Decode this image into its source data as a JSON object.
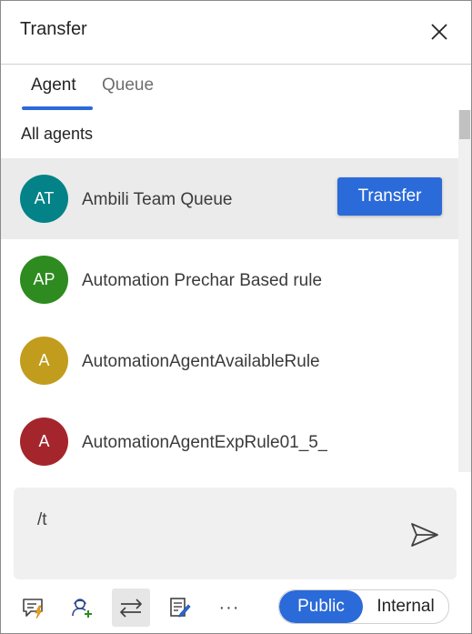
{
  "header": {
    "title": "Transfer",
    "close_icon": "close-icon"
  },
  "tabs": [
    {
      "label": "Agent",
      "selected": true
    },
    {
      "label": "Queue",
      "selected": false
    }
  ],
  "section_label": "All agents",
  "agents": [
    {
      "initials": "AT",
      "name": "Ambili Team Queue",
      "avatar_color": "#038387",
      "selected": true
    },
    {
      "initials": "AP",
      "name": "Automation Prechar Based rule",
      "avatar_color": "#2e8b1f",
      "selected": false
    },
    {
      "initials": "A",
      "name": "AutomationAgentAvailableRule",
      "avatar_color": "#c29c1d",
      "selected": false
    },
    {
      "initials": "A",
      "name": "AutomationAgentExpRule01_5_",
      "avatar_color": "#a4262c",
      "selected": false
    }
  ],
  "transfer_button": {
    "label": "Transfer"
  },
  "compose": {
    "text": "/t",
    "send_icon": "send-icon"
  },
  "toolbar": {
    "icons": [
      "quick-replies-icon",
      "add-participant-icon",
      "transfer-icon",
      "notes-icon",
      "more-icon"
    ],
    "more_label": "···",
    "visibility": {
      "public_label": "Public",
      "internal_label": "Internal",
      "selected": "Public"
    }
  },
  "colors": {
    "accent": "#2b6ad9",
    "selected_row": "#ebebeb",
    "compose_bg": "#f0f0f0"
  }
}
